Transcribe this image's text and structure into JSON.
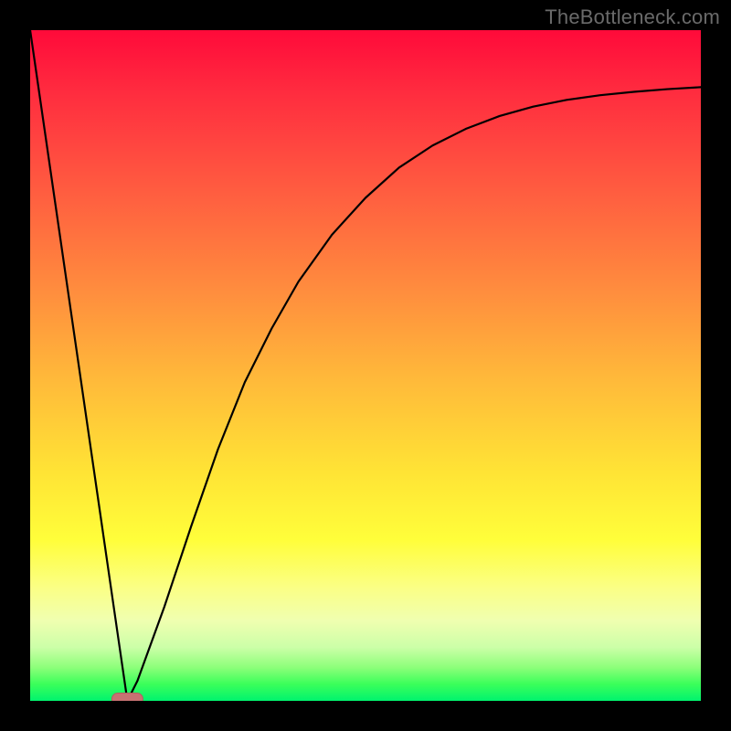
{
  "watermark": {
    "text": "TheBottleneck.com"
  },
  "marker": {
    "color": "#c77272",
    "shape": "pill"
  },
  "gradient_note": "red-to-green vertical heat gradient; green only at very bottom band",
  "chart_data": {
    "type": "line",
    "title": "",
    "xlabel": "",
    "ylabel": "",
    "xlim": [
      0,
      1
    ],
    "ylim": [
      0,
      1
    ],
    "annotations": [
      {
        "kind": "marker",
        "shape": "pill",
        "x": 0.145,
        "y": 0.0,
        "color": "#c77272"
      }
    ],
    "series": [
      {
        "name": "curve",
        "x": [
          0.0,
          0.05,
          0.1,
          0.13,
          0.145,
          0.16,
          0.2,
          0.24,
          0.28,
          0.32,
          0.36,
          0.4,
          0.45,
          0.5,
          0.55,
          0.6,
          0.65,
          0.7,
          0.75,
          0.8,
          0.85,
          0.9,
          0.95,
          1.0
        ],
        "y": [
          1.0,
          0.655,
          0.31,
          0.103,
          0.0,
          0.03,
          0.14,
          0.26,
          0.375,
          0.475,
          0.555,
          0.625,
          0.695,
          0.75,
          0.795,
          0.828,
          0.853,
          0.872,
          0.886,
          0.896,
          0.903,
          0.908,
          0.912,
          0.915
        ]
      }
    ]
  }
}
